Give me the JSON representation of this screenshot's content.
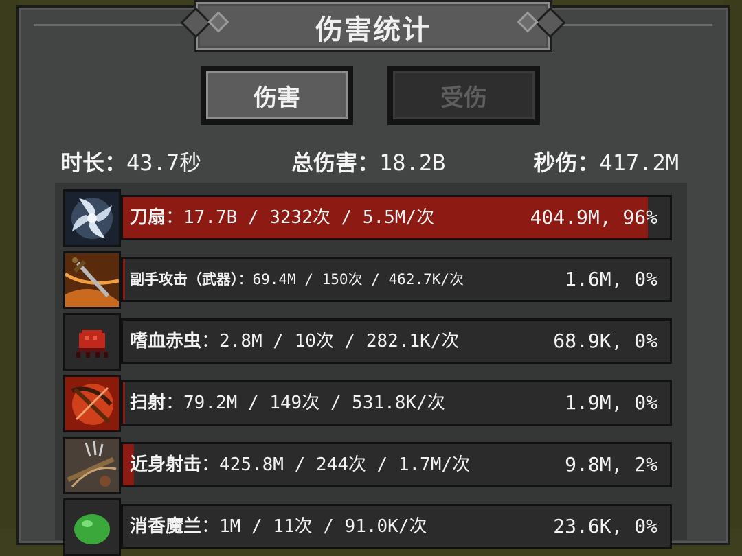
{
  "title": "伤害统计",
  "tabs": {
    "damage": "伤害",
    "taken": "受伤"
  },
  "stats": {
    "duration_label": "时长：",
    "duration_value": "43.7秒",
    "total_label": "总伤害：",
    "total_value": "18.2B",
    "dps_label": "秒伤：",
    "dps_value": "417.2M"
  },
  "rows": [
    {
      "name": "刀扇",
      "detail": "：17.7B / 3232次 / 5.5M/次",
      "value": "404.9M, 96%",
      "percent": 96,
      "icon": "blade-fan-icon"
    },
    {
      "name": "副手攻击（武器）",
      "detail": "：69.4M / 150次 / 462.7K/次",
      "value": "1.6M, 0%",
      "percent": 0.4,
      "icon": "offhand-sword-icon"
    },
    {
      "name": "嗜血赤虫",
      "detail": "：2.8M / 10次 / 282.1K/次",
      "value": "68.9K, 0%",
      "percent": 0,
      "icon": "red-bug-icon"
    },
    {
      "name": "扫射",
      "detail": "：79.2M / 149次 / 531.8K/次",
      "value": "1.9M, 0%",
      "percent": 0.4,
      "icon": "crossbow-icon"
    },
    {
      "name": "近身射击",
      "detail": "：425.8M / 244次 / 1.7M/次",
      "value": "9.8M, 2%",
      "percent": 2,
      "icon": "point-blank-shot-icon"
    },
    {
      "name": "消香魔兰",
      "detail": "：1M / 11次 / 91.0K/次",
      "value": "23.6K, 0%",
      "percent": 0,
      "icon": "green-slime-icon"
    }
  ],
  "colors": {
    "bar_fill": "#8e1a14",
    "panel": "#434444",
    "background": "#3e3f1e"
  }
}
